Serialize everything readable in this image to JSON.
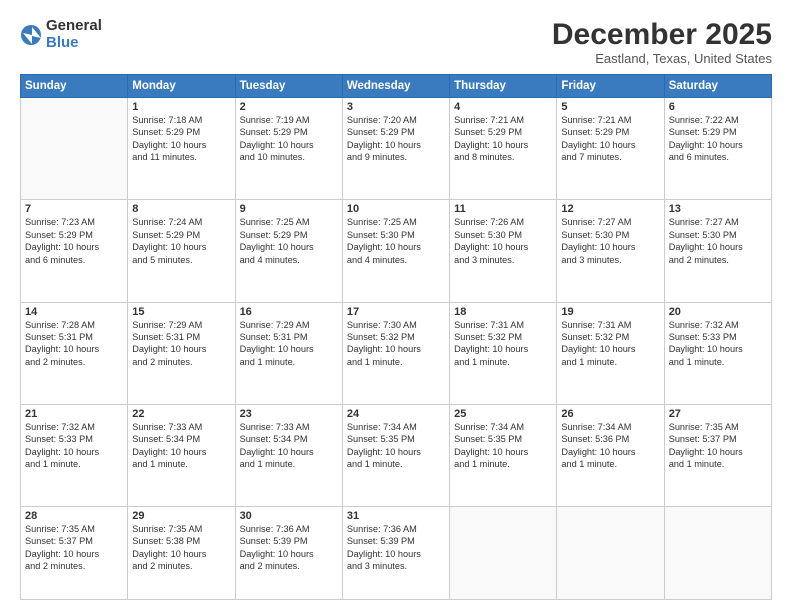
{
  "logo": {
    "general": "General",
    "blue": "Blue"
  },
  "title": "December 2025",
  "location": "Eastland, Texas, United States",
  "days_of_week": [
    "Sunday",
    "Monday",
    "Tuesday",
    "Wednesday",
    "Thursday",
    "Friday",
    "Saturday"
  ],
  "weeks": [
    [
      {
        "num": "",
        "info": ""
      },
      {
        "num": "1",
        "info": "Sunrise: 7:18 AM\nSunset: 5:29 PM\nDaylight: 10 hours\nand 11 minutes."
      },
      {
        "num": "2",
        "info": "Sunrise: 7:19 AM\nSunset: 5:29 PM\nDaylight: 10 hours\nand 10 minutes."
      },
      {
        "num": "3",
        "info": "Sunrise: 7:20 AM\nSunset: 5:29 PM\nDaylight: 10 hours\nand 9 minutes."
      },
      {
        "num": "4",
        "info": "Sunrise: 7:21 AM\nSunset: 5:29 PM\nDaylight: 10 hours\nand 8 minutes."
      },
      {
        "num": "5",
        "info": "Sunrise: 7:21 AM\nSunset: 5:29 PM\nDaylight: 10 hours\nand 7 minutes."
      },
      {
        "num": "6",
        "info": "Sunrise: 7:22 AM\nSunset: 5:29 PM\nDaylight: 10 hours\nand 6 minutes."
      }
    ],
    [
      {
        "num": "7",
        "info": "Sunrise: 7:23 AM\nSunset: 5:29 PM\nDaylight: 10 hours\nand 6 minutes."
      },
      {
        "num": "8",
        "info": "Sunrise: 7:24 AM\nSunset: 5:29 PM\nDaylight: 10 hours\nand 5 minutes."
      },
      {
        "num": "9",
        "info": "Sunrise: 7:25 AM\nSunset: 5:29 PM\nDaylight: 10 hours\nand 4 minutes."
      },
      {
        "num": "10",
        "info": "Sunrise: 7:25 AM\nSunset: 5:30 PM\nDaylight: 10 hours\nand 4 minutes."
      },
      {
        "num": "11",
        "info": "Sunrise: 7:26 AM\nSunset: 5:30 PM\nDaylight: 10 hours\nand 3 minutes."
      },
      {
        "num": "12",
        "info": "Sunrise: 7:27 AM\nSunset: 5:30 PM\nDaylight: 10 hours\nand 3 minutes."
      },
      {
        "num": "13",
        "info": "Sunrise: 7:27 AM\nSunset: 5:30 PM\nDaylight: 10 hours\nand 2 minutes."
      }
    ],
    [
      {
        "num": "14",
        "info": "Sunrise: 7:28 AM\nSunset: 5:31 PM\nDaylight: 10 hours\nand 2 minutes."
      },
      {
        "num": "15",
        "info": "Sunrise: 7:29 AM\nSunset: 5:31 PM\nDaylight: 10 hours\nand 2 minutes."
      },
      {
        "num": "16",
        "info": "Sunrise: 7:29 AM\nSunset: 5:31 PM\nDaylight: 10 hours\nand 1 minute."
      },
      {
        "num": "17",
        "info": "Sunrise: 7:30 AM\nSunset: 5:32 PM\nDaylight: 10 hours\nand 1 minute."
      },
      {
        "num": "18",
        "info": "Sunrise: 7:31 AM\nSunset: 5:32 PM\nDaylight: 10 hours\nand 1 minute."
      },
      {
        "num": "19",
        "info": "Sunrise: 7:31 AM\nSunset: 5:32 PM\nDaylight: 10 hours\nand 1 minute."
      },
      {
        "num": "20",
        "info": "Sunrise: 7:32 AM\nSunset: 5:33 PM\nDaylight: 10 hours\nand 1 minute."
      }
    ],
    [
      {
        "num": "21",
        "info": "Sunrise: 7:32 AM\nSunset: 5:33 PM\nDaylight: 10 hours\nand 1 minute."
      },
      {
        "num": "22",
        "info": "Sunrise: 7:33 AM\nSunset: 5:34 PM\nDaylight: 10 hours\nand 1 minute."
      },
      {
        "num": "23",
        "info": "Sunrise: 7:33 AM\nSunset: 5:34 PM\nDaylight: 10 hours\nand 1 minute."
      },
      {
        "num": "24",
        "info": "Sunrise: 7:34 AM\nSunset: 5:35 PM\nDaylight: 10 hours\nand 1 minute."
      },
      {
        "num": "25",
        "info": "Sunrise: 7:34 AM\nSunset: 5:35 PM\nDaylight: 10 hours\nand 1 minute."
      },
      {
        "num": "26",
        "info": "Sunrise: 7:34 AM\nSunset: 5:36 PM\nDaylight: 10 hours\nand 1 minute."
      },
      {
        "num": "27",
        "info": "Sunrise: 7:35 AM\nSunset: 5:37 PM\nDaylight: 10 hours\nand 1 minute."
      }
    ],
    [
      {
        "num": "28",
        "info": "Sunrise: 7:35 AM\nSunset: 5:37 PM\nDaylight: 10 hours\nand 2 minutes."
      },
      {
        "num": "29",
        "info": "Sunrise: 7:35 AM\nSunset: 5:38 PM\nDaylight: 10 hours\nand 2 minutes."
      },
      {
        "num": "30",
        "info": "Sunrise: 7:36 AM\nSunset: 5:39 PM\nDaylight: 10 hours\nand 2 minutes."
      },
      {
        "num": "31",
        "info": "Sunrise: 7:36 AM\nSunset: 5:39 PM\nDaylight: 10 hours\nand 3 minutes."
      },
      {
        "num": "",
        "info": ""
      },
      {
        "num": "",
        "info": ""
      },
      {
        "num": "",
        "info": ""
      }
    ]
  ]
}
